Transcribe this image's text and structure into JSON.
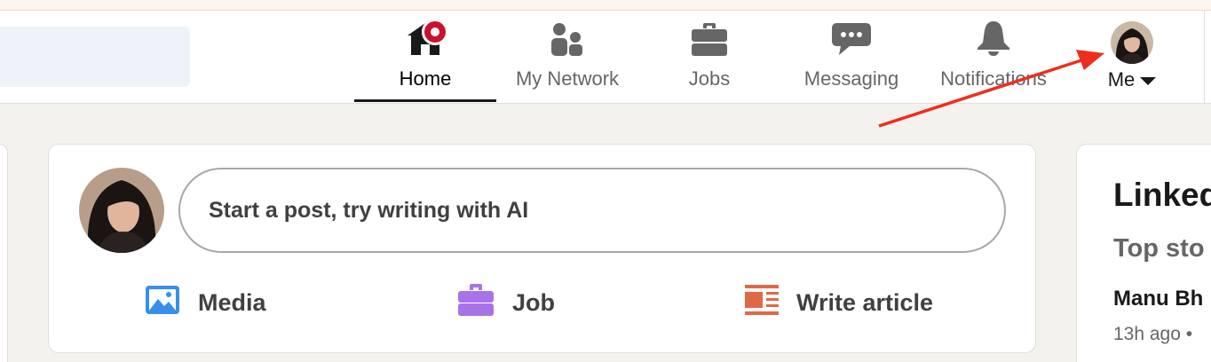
{
  "nav": {
    "items": [
      {
        "label": "Home",
        "icon": "home-icon",
        "active": true,
        "badge": true
      },
      {
        "label": "My Network",
        "icon": "people-icon"
      },
      {
        "label": "Jobs",
        "icon": "briefcase-icon"
      },
      {
        "label": "Messaging",
        "icon": "chat-bubble-icon"
      },
      {
        "label": "Notifications",
        "icon": "bell-icon"
      }
    ],
    "me": {
      "label": "Me",
      "icon": "chevron-down-icon"
    }
  },
  "share_box": {
    "placeholder": "Start a post, try writing with AI",
    "actions": [
      {
        "label": "Media",
        "icon": "image-icon",
        "color": "#378fe9"
      },
      {
        "label": "Job",
        "icon": "briefcase-icon",
        "color": "#a872e8"
      },
      {
        "label": "Write article",
        "icon": "article-icon",
        "color": "#e06847"
      }
    ]
  },
  "news": {
    "title": "Linked",
    "subtitle": "Top sto",
    "item_title": "Manu Bh",
    "item_meta": "13h ago •"
  },
  "colors": {
    "background": "#f4f2ee",
    "badge": "#cb112d",
    "annotation_arrow": "#ee2e1d"
  }
}
